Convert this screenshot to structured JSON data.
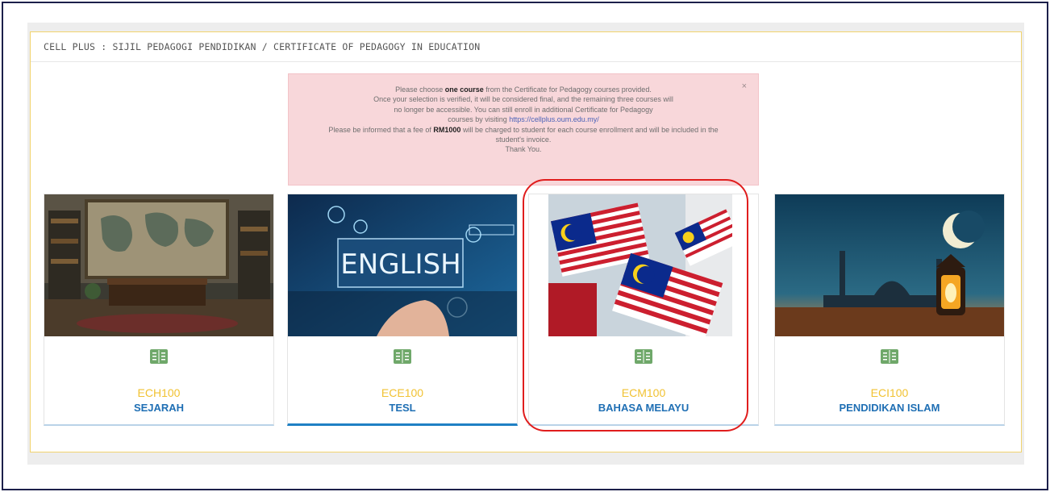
{
  "panel": {
    "title": "CELL PLUS : SIJIL PEDAGOGI PENDIDIKAN / CERTIFICATE OF PEDAGOGY IN EDUCATION"
  },
  "notice": {
    "line1_pre": "Please choose ",
    "line1_bold": "one course",
    "line1_post": " from the Certificate for Pedagogy courses provided.",
    "line2": "Once your selection is verified, it will be considered final, and the remaining three courses will",
    "line3": "no longer be accessible. You can still enroll in additional Certificate for Pedagogy",
    "line4_pre": "courses by visiting ",
    "line4_link": "https://cellplus.oum.edu.my/",
    "line5_pre": "Please be informed that a fee of ",
    "line5_bold": "RM1000",
    "line5_post": " will be charged to student for each course enrollment and will be included in the",
    "line6": "student's invoice.",
    "line7": "Thank You.",
    "close": "×"
  },
  "courses": [
    {
      "code": "ECH100",
      "name": "SEJARAH",
      "icon": "book-icon"
    },
    {
      "code": "ECE100",
      "name": "TESL",
      "icon": "book-icon",
      "image_text": "ENGLISH"
    },
    {
      "code": "ECM100",
      "name": "BAHASA MELAYU",
      "icon": "book-icon"
    },
    {
      "code": "ECI100",
      "name": "PENDIDIKAN ISLAM",
      "icon": "book-icon"
    }
  ],
  "colors": {
    "code": "#f1c232",
    "name": "#1f6fb4",
    "icon": "#6fa86a",
    "highlight": "#e01d1d",
    "notice_bg": "#f8d7da",
    "panel_border": "#f1d36e"
  }
}
